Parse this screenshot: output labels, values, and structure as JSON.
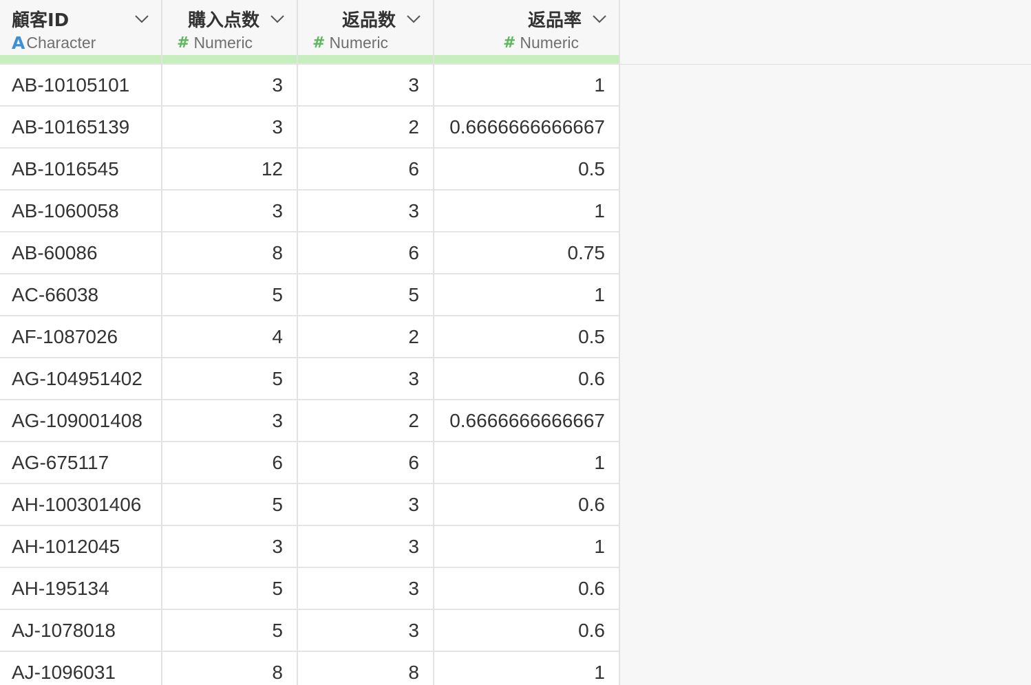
{
  "columns": [
    {
      "name": "顧客ID",
      "type_label": "Character",
      "type_icon": "A",
      "type_icon_name": "character-type-icon"
    },
    {
      "name": "購入点数",
      "type_label": "Numeric",
      "type_icon": "#",
      "type_icon_name": "numeric-type-icon"
    },
    {
      "name": "返品数",
      "type_label": "Numeric",
      "type_icon": "#",
      "type_icon_name": "numeric-type-icon"
    },
    {
      "name": "返品率",
      "type_label": "Numeric",
      "type_icon": "#",
      "type_icon_name": "numeric-type-icon"
    }
  ],
  "colors": {
    "character_type": "#3d8fd6",
    "numeric_type": "#5cb85c",
    "quality_bar": "#c7efbd"
  },
  "rows": [
    [
      "AB-10105101",
      "3",
      "3",
      "1"
    ],
    [
      "AB-10165139",
      "3",
      "2",
      "0.6666666666667"
    ],
    [
      "AB-1016545",
      "12",
      "6",
      "0.5"
    ],
    [
      "AB-1060058",
      "3",
      "3",
      "1"
    ],
    [
      "AB-60086",
      "8",
      "6",
      "0.75"
    ],
    [
      "AC-66038",
      "5",
      "5",
      "1"
    ],
    [
      "AF-1087026",
      "4",
      "2",
      "0.5"
    ],
    [
      "AG-104951402",
      "5",
      "3",
      "0.6"
    ],
    [
      "AG-109001408",
      "3",
      "2",
      "0.6666666666667"
    ],
    [
      "AG-675117",
      "6",
      "6",
      "1"
    ],
    [
      "AH-100301406",
      "5",
      "3",
      "0.6"
    ],
    [
      "AH-1012045",
      "3",
      "3",
      "1"
    ],
    [
      "AH-195134",
      "5",
      "3",
      "0.6"
    ],
    [
      "AJ-1078018",
      "5",
      "3",
      "0.6"
    ],
    [
      "AJ-1096031",
      "8",
      "8",
      "1"
    ]
  ]
}
